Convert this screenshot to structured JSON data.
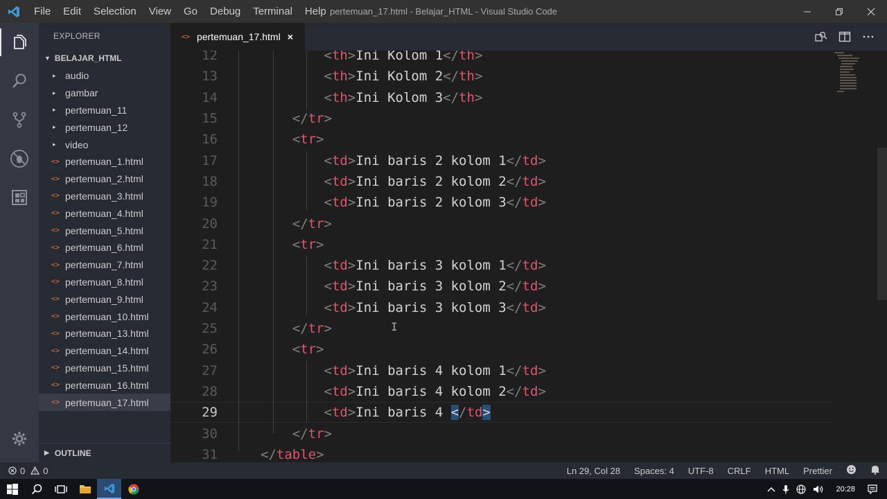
{
  "titlebar": {
    "menu": [
      "File",
      "Edit",
      "Selection",
      "View",
      "Go",
      "Debug",
      "Terminal",
      "Help"
    ],
    "title": "pertemuan_17.html - Belajar_HTML - Visual Studio Code"
  },
  "activitybar": {
    "icons": [
      "explorer-icon",
      "search-icon",
      "source-control-icon",
      "debug-icon",
      "extensions-icon"
    ],
    "bottom_icon": "gear-icon"
  },
  "sidebar": {
    "title": "EXPLORER",
    "folder": "BELAJAR_HTML",
    "folders": [
      "audio",
      "gambar",
      "pertemuan_11",
      "pertemuan_12",
      "video"
    ],
    "files": [
      "pertemuan_1.html",
      "pertemuan_2.html",
      "pertemuan_3.html",
      "pertemuan_4.html",
      "pertemuan_5.html",
      "pertemuan_6.html",
      "pertemuan_7.html",
      "pertemuan_8.html",
      "pertemuan_9.html",
      "pertemuan_10.html",
      "pertemuan_13.html",
      "pertemuan_14.html",
      "pertemuan_15.html",
      "pertemuan_16.html",
      "pertemuan_17.html"
    ],
    "selected_file": "pertemuan_17.html",
    "outline": "OUTLINE"
  },
  "tab": {
    "label": "pertemuan_17.html",
    "close": "×"
  },
  "editor": {
    "current_line": 29,
    "lines": [
      {
        "n": "12",
        "indent": 3,
        "tag": "th",
        "text": "Ini Kolom 1",
        "kind": "pair"
      },
      {
        "n": "13",
        "indent": 3,
        "tag": "th",
        "text": "Ini Kolom 2",
        "kind": "pair"
      },
      {
        "n": "14",
        "indent": 3,
        "tag": "th",
        "text": "Ini Kolom 3",
        "kind": "pair"
      },
      {
        "n": "15",
        "indent": 2,
        "tag": "tr",
        "kind": "close"
      },
      {
        "n": "16",
        "indent": 2,
        "tag": "tr",
        "kind": "open"
      },
      {
        "n": "17",
        "indent": 3,
        "tag": "td",
        "text": "Ini baris 2 kolom 1",
        "kind": "pair"
      },
      {
        "n": "18",
        "indent": 3,
        "tag": "td",
        "text": "Ini baris 2 kolom 2",
        "kind": "pair"
      },
      {
        "n": "19",
        "indent": 3,
        "tag": "td",
        "text": "Ini baris 2 kolom 3",
        "kind": "pair"
      },
      {
        "n": "20",
        "indent": 2,
        "tag": "tr",
        "kind": "close"
      },
      {
        "n": "21",
        "indent": 2,
        "tag": "tr",
        "kind": "open"
      },
      {
        "n": "22",
        "indent": 3,
        "tag": "td",
        "text": "Ini baris 3 kolom 1",
        "kind": "pair"
      },
      {
        "n": "23",
        "indent": 3,
        "tag": "td",
        "text": "Ini baris 3 kolom 2",
        "kind": "pair"
      },
      {
        "n": "24",
        "indent": 3,
        "tag": "td",
        "text": "Ini baris 3 kolom 3",
        "kind": "pair"
      },
      {
        "n": "25",
        "indent": 2,
        "tag": "tr",
        "kind": "close"
      },
      {
        "n": "26",
        "indent": 2,
        "tag": "tr",
        "kind": "open"
      },
      {
        "n": "27",
        "indent": 3,
        "tag": "td",
        "text": "Ini baris 4 kolom 1",
        "kind": "pair"
      },
      {
        "n": "28",
        "indent": 3,
        "tag": "td",
        "text": "Ini baris 4 kolom 2",
        "kind": "pair"
      },
      {
        "n": "29",
        "indent": 3,
        "tag": "td",
        "text": "Ini baris 4 ",
        "kind": "pair-cursor"
      },
      {
        "n": "30",
        "indent": 2,
        "tag": "tr",
        "kind": "close"
      },
      {
        "n": "31",
        "indent": 1,
        "tag": "table",
        "kind": "close"
      }
    ]
  },
  "statusbar": {
    "errors": "0",
    "warnings": "0",
    "position": "Ln 29, Col 28",
    "spaces": "Spaces: 4",
    "encoding": "UTF-8",
    "eol": "CRLF",
    "language": "HTML",
    "formatter": "Prettier"
  },
  "taskbar": {
    "time": "20:28"
  },
  "colors": {
    "tag": "#e0556c",
    "punct": "#808080",
    "text": "#d4d4d4",
    "file_icon": "#e37933"
  }
}
